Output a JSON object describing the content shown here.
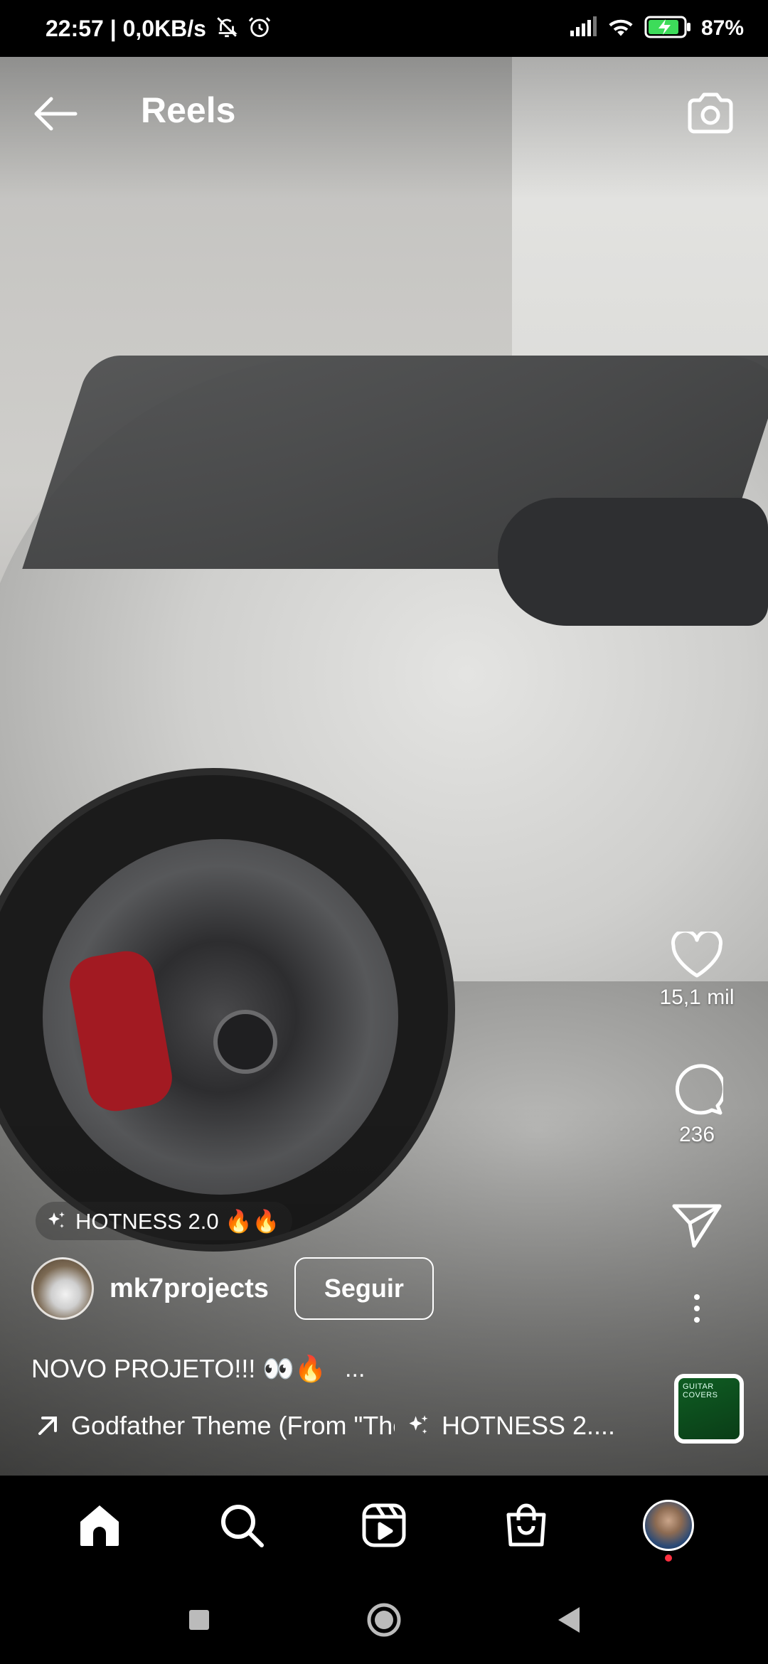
{
  "status_bar": {
    "time": "22:57 | 0,0KB/s",
    "battery": "87%",
    "icons": [
      "dnd-muted-icon",
      "alarm-icon",
      "signal-icon",
      "wifi-icon",
      "battery-charging-icon"
    ]
  },
  "header": {
    "title": "Reels",
    "back_icon": "arrow-left-icon",
    "camera_icon": "camera-icon"
  },
  "actions": {
    "likes": "15,1 mil",
    "comments": "236"
  },
  "post": {
    "effect": "HOTNESS 2.0 🔥🔥",
    "username": "mk7projects",
    "follow_label": "Seguir",
    "caption": "NOVO PROJETO!!! 👀🔥",
    "caption_more": "...",
    "audio_track": "Godfather Theme (From \"The Godfather\")",
    "audio_effect": "HOTNESS 2...."
  },
  "audio_thumb_text": "GUITAR COVERS",
  "bottom_nav": {
    "items": [
      "home-icon",
      "search-icon",
      "reels-icon",
      "shop-icon",
      "profile-avatar"
    ]
  }
}
